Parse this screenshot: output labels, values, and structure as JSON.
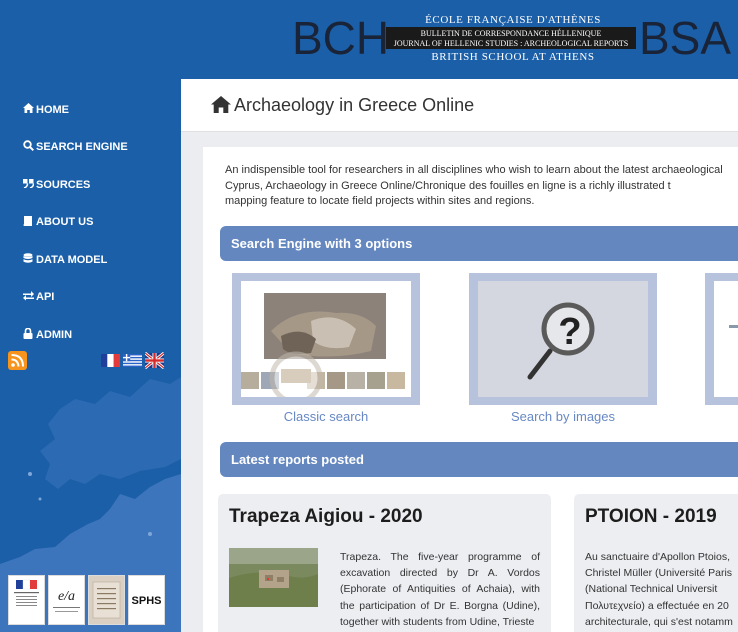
{
  "banner": {
    "bch": "BCH",
    "bsa": "BSA",
    "efa": "ÉCOLE FRANÇAISE D'ATHÈNES",
    "bch_line1": "BULLETIN DE CORRESPONDANCE HÉLLENIQUE",
    "bch_line2": "JOURNAL OF HELLENIC STUDIES : ARCHEOLOGICAL REPORTS",
    "bsa_text": "BRITISH SCHOOL AT ATHENS"
  },
  "nav": [
    {
      "label": "HOME",
      "icon": "home-icon"
    },
    {
      "label": "SEARCH ENGINE",
      "icon": "search-icon"
    },
    {
      "label": "SOURCES",
      "icon": "quote-icon"
    },
    {
      "label": "ABOUT US",
      "icon": "book-icon"
    },
    {
      "label": "DATA MODEL",
      "icon": "database-icon"
    },
    {
      "label": "API",
      "icon": "exchange-icon"
    },
    {
      "label": "ADMIN",
      "icon": "lock-icon"
    }
  ],
  "page_title": "Archaeology in Greece Online",
  "intro": {
    "line1": "An indispensible tool for researchers in all disciplines who wish to learn about the latest archaeological",
    "line2": "Cyprus, Archaeology in Greece Online/Chronique des fouilles en ligne is a richly illustrated t",
    "line3": "mapping feature to locate field projects within sites and regions."
  },
  "search_section": {
    "title": "Search Engine with 3 options",
    "options": [
      "Classic search",
      "Search by images",
      ""
    ]
  },
  "reports_section": {
    "title": "Latest reports posted"
  },
  "reports": [
    {
      "title": "Trapeza Aigiou - 2020",
      "text": "Trapeza. The five-year programme of excavation directed by Dr A. Vordos (Ephorate of Antiquities of Achaia), with the participation of Dr E. Borgna (Udine), together with students from Udine, Trieste"
    },
    {
      "title": "PTOION - 2019",
      "line1": "Au sanctuaire d'Apollon Ptoios,",
      "line2": "Christel Müller (Université Paris",
      "line3": "(National Technical Universit",
      "line4": "Πολυτεχνείο) a effectuée en 20",
      "line5": "architecturale, qui s'est notamm"
    }
  ],
  "logos": [
    "MINISTÈRE",
    "EFA",
    "BRITISH SCHOOL AT ATHENS",
    "SPH S"
  ],
  "colors": {
    "sidebar": "#1b5fa8",
    "section_bar": "#6487bf",
    "card_frame": "#b7c2dd",
    "link": "#6788c4"
  }
}
